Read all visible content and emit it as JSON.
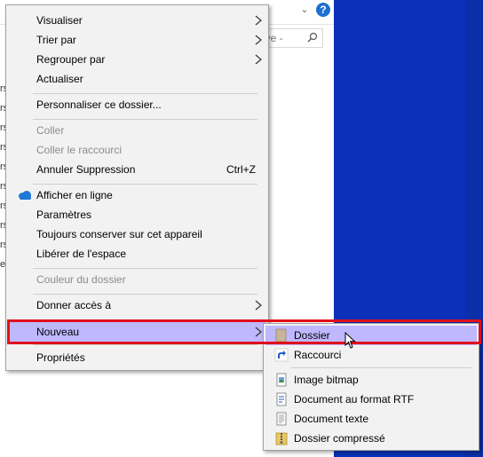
{
  "explorer": {
    "search_placeholder": "ive -",
    "left_fragments": [
      "rs",
      "rs",
      "rs",
      "rs",
      "rs",
      "rs",
      "rs",
      "rs",
      "rs",
      "e"
    ]
  },
  "menu": {
    "items": [
      {
        "label": "Visualiser",
        "submenu": true
      },
      {
        "label": "Trier par",
        "submenu": true
      },
      {
        "label": "Regrouper par",
        "submenu": true
      },
      {
        "label": "Actualiser"
      },
      {
        "label": "Personnaliser ce dossier..."
      },
      {
        "label": "Coller",
        "disabled": true
      },
      {
        "label": "Coller le raccourci",
        "disabled": true
      },
      {
        "label": "Annuler Suppression",
        "shortcut": "Ctrl+Z"
      },
      {
        "label": "Afficher en ligne",
        "icon": "onedrive-cloud-icon"
      },
      {
        "label": "Paramètres"
      },
      {
        "label": "Toujours conserver sur cet appareil"
      },
      {
        "label": "Libérer de l'espace"
      },
      {
        "label": "Couleur du dossier",
        "disabled": true
      },
      {
        "label": "Donner accès à",
        "submenu": true
      },
      {
        "label": "Nouveau",
        "submenu": true,
        "highlighted": true
      },
      {
        "label": "Propriétés"
      }
    ]
  },
  "submenu": {
    "items": [
      {
        "label": "Dossier",
        "icon": "folder-icon",
        "highlighted": true
      },
      {
        "label": "Raccourci",
        "icon": "shortcut-icon"
      },
      {
        "label": "Image bitmap",
        "icon": "bitmap-icon"
      },
      {
        "label": "Document au format RTF",
        "icon": "rtf-document-icon"
      },
      {
        "label": "Document texte",
        "icon": "text-document-icon"
      },
      {
        "label": "Dossier compressé",
        "icon": "zip-folder-icon"
      }
    ]
  },
  "colors": {
    "desktop": "#0a31b8",
    "highlight": "#bfb8ff",
    "annotation": "#e0101a",
    "menu_bg": "#f2f2f2"
  }
}
